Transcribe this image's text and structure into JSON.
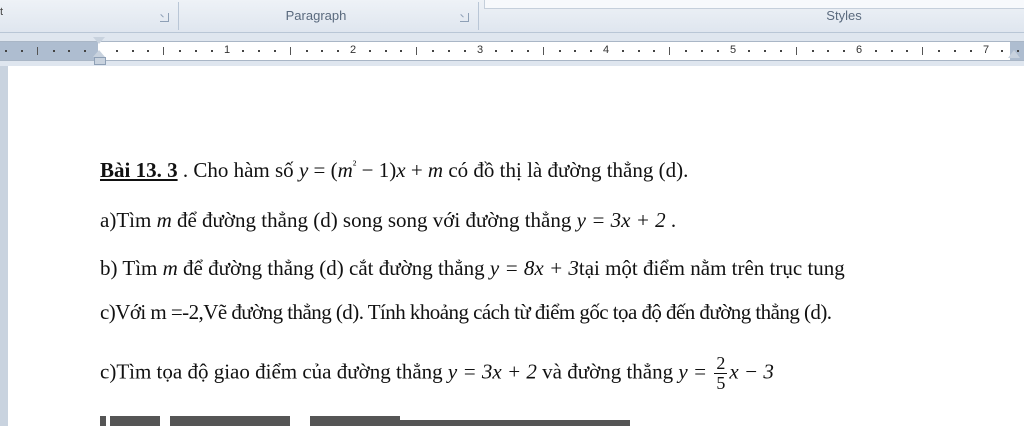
{
  "ribbon": {
    "clip_text": "t",
    "paragraph_label": "Paragraph",
    "styles_label": "Styles"
  },
  "ruler": {
    "numbers": [
      "1",
      "2",
      "3",
      "4",
      "5",
      "6",
      "7"
    ]
  },
  "document": {
    "line1": {
      "title": "Bài 13. 3",
      "text1": " . Cho  hàm số ",
      "eq_y": "y",
      "eq_mid": " = (",
      "eq_m": "m",
      "eq_sup": "²",
      "eq_rest": " − 1)",
      "eq_x": "x",
      "eq_plus": " + ",
      "eq_m2": "m",
      "text2": "  có đồ thị là đường thẳng (d)."
    },
    "line2": {
      "a": "a)Tìm ",
      "m": "m",
      "b": " để đường thẳng  (d) song song với đường thẳng ",
      "eq": "y = 3x + 2",
      "end": " ."
    },
    "line3": {
      "a": "b) Tìm ",
      "m": "m",
      "b": " để đường thẳng  (d) cắt đường thẳng ",
      "eq": "y = 8x + 3",
      "c": "tại một điểm nằm trên trục tung"
    },
    "line4": "c)Với m =-2,Vẽ đường thẳng (d). Tính khoảng cách từ điểm gốc tọa độ đến đường thẳng (d).",
    "line5": {
      "a": "c)Tìm tọa độ giao điểm của đường thẳng ",
      "eq1": "y = 3x + 2",
      "b": " và đường thẳng ",
      "eq2_y": "y = ",
      "frac_num": "2",
      "frac_den": "5",
      "eq2_rest": "x − 3"
    }
  }
}
